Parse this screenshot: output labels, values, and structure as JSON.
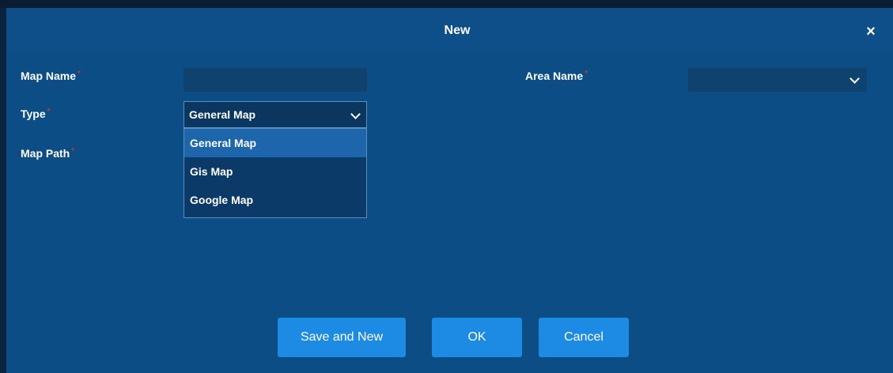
{
  "dialog": {
    "title": "New",
    "close_label": "×"
  },
  "form": {
    "map_name_label": "Map Name",
    "area_name_label": "Area Name",
    "type_label": "Type",
    "map_path_label": "Map Path",
    "required_marker": "*",
    "map_name_value": "",
    "area_name_value": "",
    "type_selected": "General Map"
  },
  "type_options": [
    "General Map",
    "Gis Map",
    "Google Map"
  ],
  "buttons": {
    "save_and_new": "Save and New",
    "ok": "OK",
    "cancel": "Cancel"
  },
  "colors": {
    "dialog_bg": "#0d4d85",
    "button_bg": "#1d8be3",
    "selected_option_bg": "#1d66ac",
    "required_marker": "#c0392b"
  }
}
